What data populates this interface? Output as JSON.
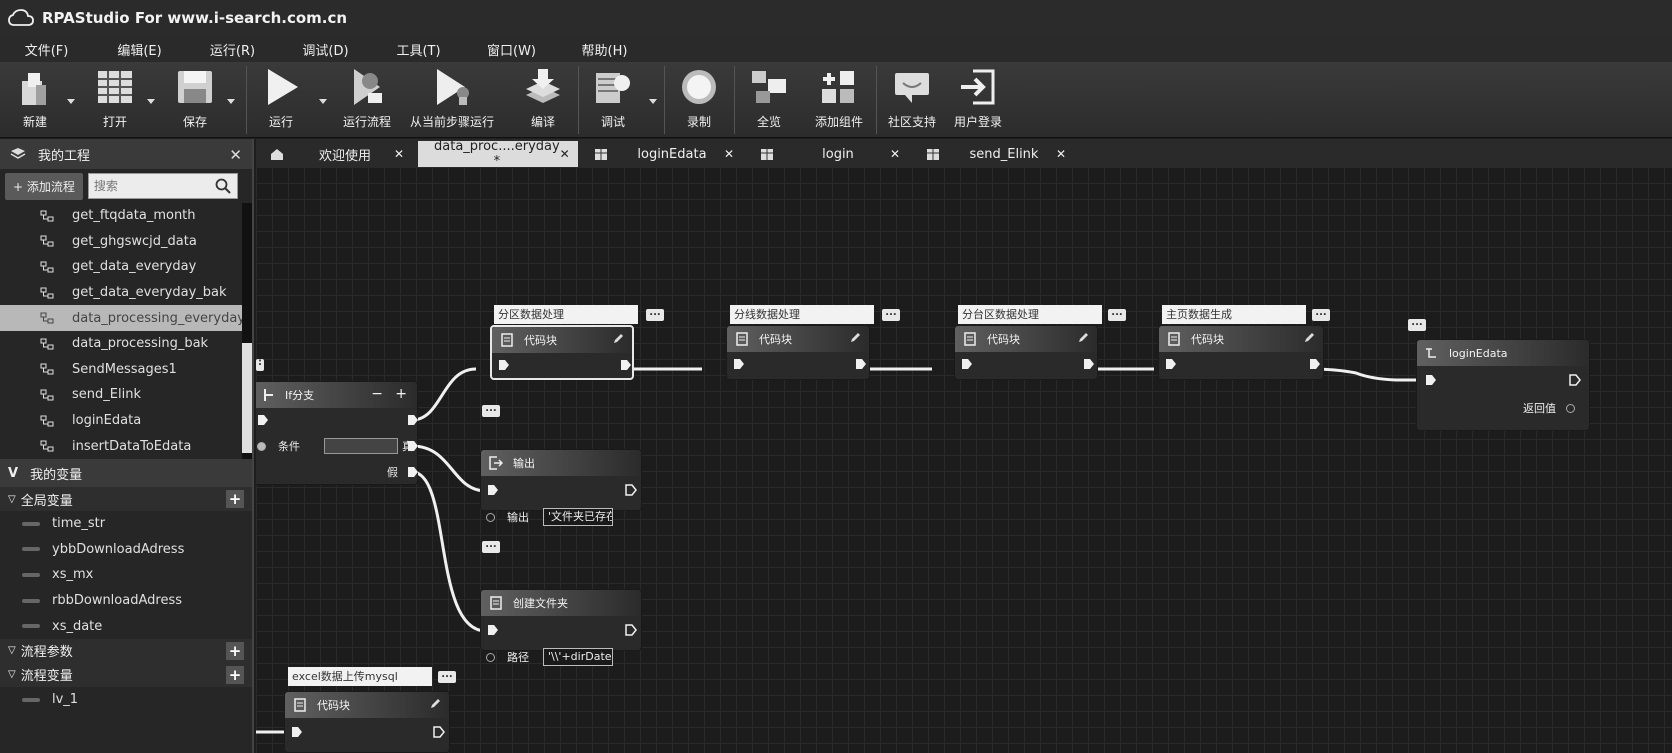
{
  "app": {
    "title": "RPAStudio For www.i-search.com.cn"
  },
  "menu": [
    "文件(F)",
    "编辑(E)",
    "运行(R)",
    "调试(D)",
    "工具(T)",
    "窗口(W)",
    "帮助(H)"
  ],
  "toolbar": {
    "new": "新建",
    "open": "打开",
    "save": "保存",
    "run": "运行",
    "run_flow": "运行流程",
    "run_from_step": "从当前步骤运行",
    "compile": "编译",
    "debug": "调试",
    "record": "录制",
    "overview": "全览",
    "add_component": "添加组件",
    "community": "社区支持",
    "login": "用户登录"
  },
  "project_panel": {
    "title": "我的工程",
    "add_flow": "+ 添加流程",
    "search_placeholder": "搜索",
    "flows": [
      "get_ftqdata_month",
      "get_ghgswcjd_data",
      "get_data_everyday",
      "get_data_everyday_bak",
      "data_processing_everyday",
      "data_processing_bak",
      "SendMessages1",
      "send_Elink",
      "loginEdata",
      "insertDataToEdata"
    ],
    "selected_index": 4
  },
  "variables_panel": {
    "title": "我的变量",
    "global_label": "全局变量",
    "globals": [
      "time_str",
      "ybbDownloadAdress",
      "xs_mx",
      "rbbDownloadAdress",
      "xs_date"
    ],
    "flow_params_label": "流程参数",
    "flow_vars_label": "流程变量",
    "flow_vars": [
      "lv_1"
    ]
  },
  "tabs": [
    {
      "label": "欢迎使用",
      "icon": "home-icon"
    },
    {
      "label": "data_proc....eryday *",
      "icon": "grid-icon",
      "active": true
    },
    {
      "label": "loginEdata",
      "icon": "grid-icon"
    },
    {
      "label": "login",
      "icon": "grid-icon"
    },
    {
      "label": "send_Elink",
      "icon": "grid-icon"
    }
  ],
  "canvas": {
    "code_block_title": "代码块",
    "labels": [
      "分区数据处理",
      "分线数据处理",
      "分台区数据处理",
      "主页数据生成",
      "excel数据上传mysql"
    ],
    "if_node": {
      "title": "If分支",
      "condition_label": "条件",
      "true_label": "真",
      "false_label": "假"
    },
    "output_node": {
      "title": "输出",
      "prop_label": "输出",
      "prop_value": "'文件夹已存在'"
    },
    "mkdir_node": {
      "title": "创建文件夹",
      "prop_label": "路径",
      "prop_value": "'\\\\'+dirDate"
    },
    "login_node": {
      "title": "loginEdata",
      "return_label": "返回值"
    },
    "more": "..."
  }
}
